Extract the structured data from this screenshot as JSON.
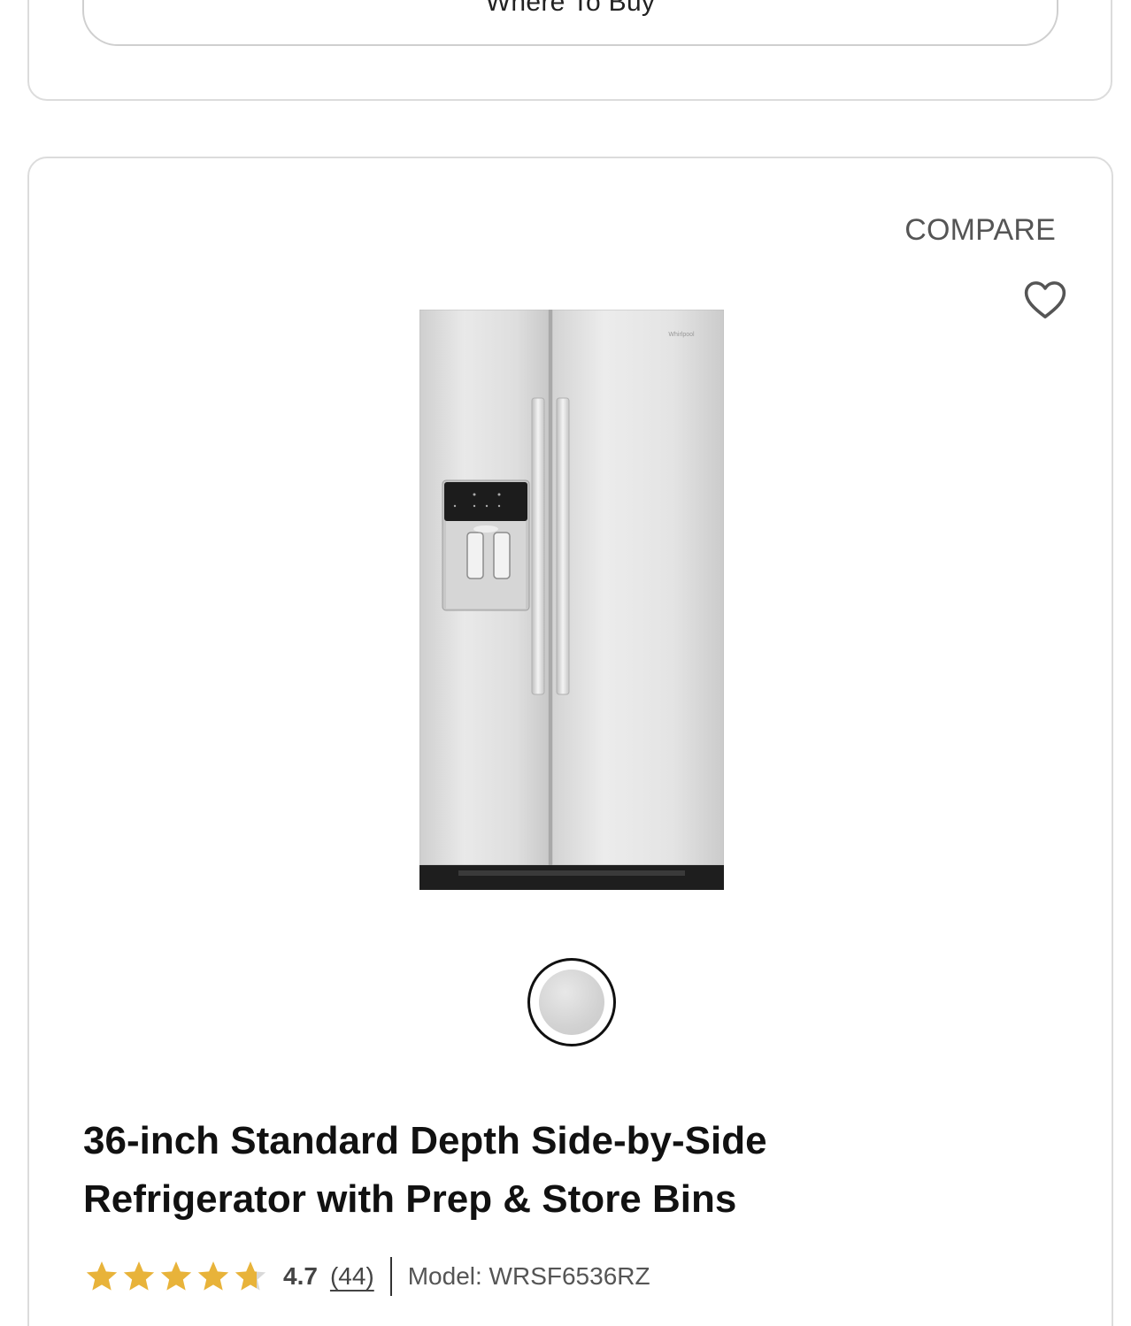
{
  "previous_card": {
    "where_to_buy_label": "Where To Buy"
  },
  "product": {
    "compare_label": "COMPARE",
    "title": "36-inch Standard Depth Side-by-Side Refrigerator with Prep & Store Bins",
    "brand_logo_text": "Whirlpool",
    "rating": {
      "value": "4.7",
      "count": "(44)",
      "stars_filled_fraction": 0.94,
      "star_color": "#E8B33A"
    },
    "model": "Model: WRSF6536RZ",
    "color_swatches": [
      {
        "name": "stainless-steel",
        "selected": true
      }
    ]
  }
}
